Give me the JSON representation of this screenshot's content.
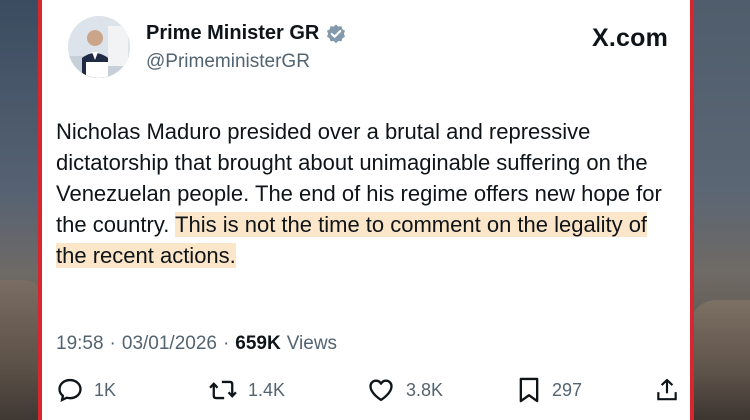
{
  "post": {
    "author": {
      "name": "Prime Minister GR",
      "handle": "@PrimeministerGR",
      "verified": true
    },
    "brand": "X.com",
    "text_plain": "Nicholas Maduro presided over a brutal and repressive dictatorship that brought about unimaginable suffering on the Venezuelan people. The end of his regime offers new hope for the country.",
    "text_highlighted": "This is not the time to comment on the legality of the recent actions.",
    "time": "19:58",
    "date": "03/01/2026",
    "separator": "·",
    "views_count": "659K",
    "views_label": "Views"
  },
  "actions": {
    "replies": "1K",
    "reposts": "1.4K",
    "likes": "3.8K",
    "bookmarks": "297"
  },
  "colors": {
    "frame_border": "#d8262e",
    "highlight": "#fbe6c9",
    "verified": "#829aab",
    "text": "#0f1419",
    "secondary_text": "#536471"
  },
  "icons": [
    "verified-badge-icon",
    "reply-icon",
    "repost-icon",
    "like-icon",
    "bookmark-icon",
    "share-icon"
  ]
}
